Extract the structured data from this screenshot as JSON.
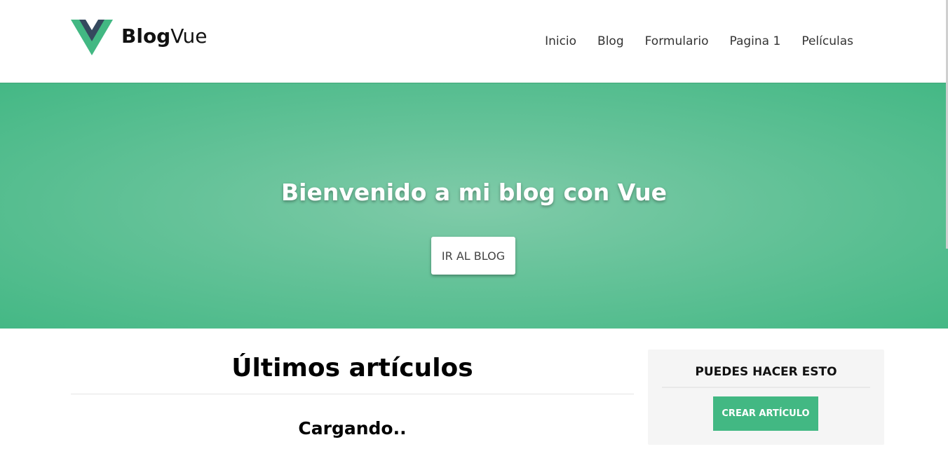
{
  "header": {
    "brand_bold": "Blog",
    "brand_light": "Vue",
    "nav": [
      "Inicio",
      "Blog",
      "Formulario",
      "Pagina 1",
      "Películas"
    ]
  },
  "hero": {
    "title": "Bienvenido a mi blog con Vue",
    "button_label": "IR AL BLOG"
  },
  "main": {
    "title": "Últimos artículos",
    "loading_text": "Cargando.."
  },
  "sidebar": {
    "title": "PUEDES HACER ESTO",
    "create_button": "CREAR ARTÍCULO"
  },
  "colors": {
    "vue_green": "#42b883",
    "vue_dark": "#35495e"
  }
}
